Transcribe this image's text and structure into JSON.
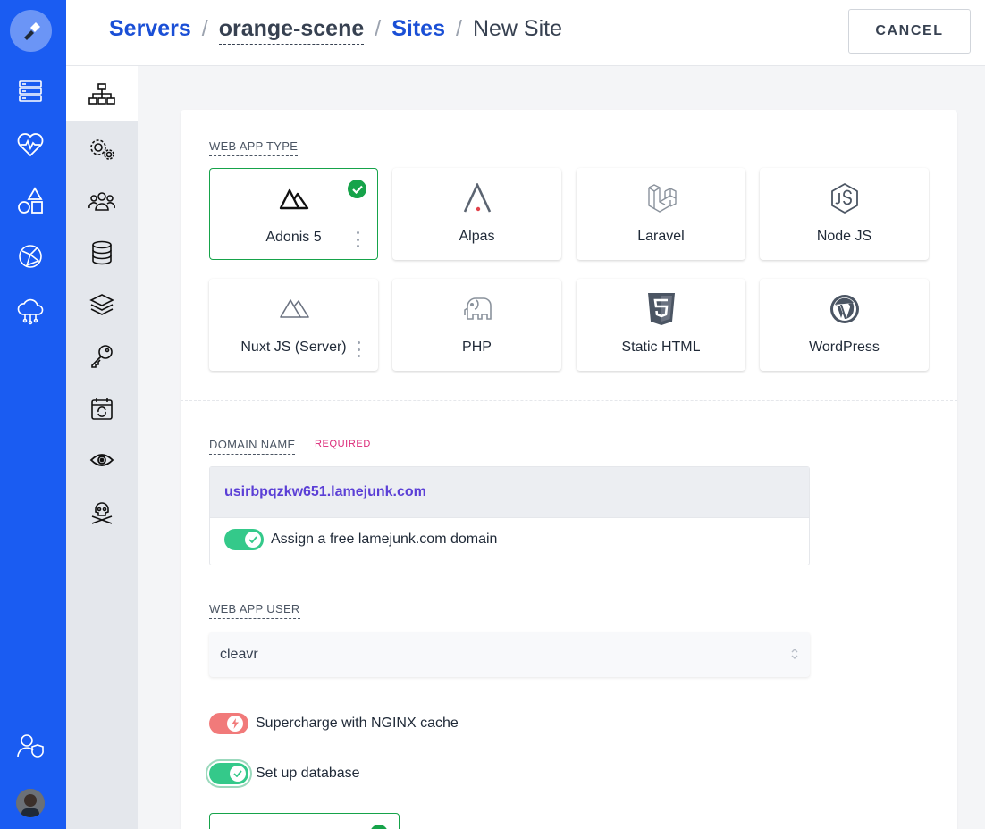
{
  "breadcrumb": {
    "servers": "Servers",
    "server_name": "orange-scene",
    "sites": "Sites",
    "current": "New Site",
    "separator": "/"
  },
  "header": {
    "cancel_label": "CANCEL"
  },
  "rail": {
    "icons": [
      "server-list-icon",
      "heartbeat-icon",
      "shapes-icon",
      "globe-network-icon",
      "cloud-network-icon",
      "user-shield-icon"
    ],
    "bottom_avatar": "avatar"
  },
  "subnav": {
    "items": [
      "sitemap-icon",
      "gears-icon",
      "users-icon",
      "database-icon",
      "layers-icon",
      "key-icon",
      "calendar-sync-icon",
      "eye-icon",
      "skull-crossbones-icon"
    ],
    "active": "sitemap-icon"
  },
  "web_app_type": {
    "label": "WEB APP TYPE",
    "options": [
      {
        "label": "Adonis 5",
        "icon": "adonis-icon",
        "selected": true,
        "has_menu": true
      },
      {
        "label": "Alpas",
        "icon": "alpas-icon",
        "selected": false,
        "has_menu": false
      },
      {
        "label": "Laravel",
        "icon": "laravel-icon",
        "selected": false,
        "has_menu": false
      },
      {
        "label": "Node JS",
        "icon": "nodejs-icon",
        "selected": false,
        "has_menu": false
      },
      {
        "label": "Nuxt JS (Server)",
        "icon": "nuxt-icon",
        "selected": false,
        "has_menu": true
      },
      {
        "label": "PHP",
        "icon": "php-elephant-icon",
        "selected": false,
        "has_menu": false
      },
      {
        "label": "Static HTML",
        "icon": "html5-icon",
        "selected": false,
        "has_menu": false
      },
      {
        "label": "WordPress",
        "icon": "wordpress-icon",
        "selected": false,
        "has_menu": false
      }
    ]
  },
  "domain": {
    "label": "DOMAIN NAME",
    "required": "REQUIRED",
    "value": "usirbpqzkw651.lamejunk.com",
    "free_domain_toggle": {
      "label": "Assign a free lamejunk.com domain",
      "on": true
    }
  },
  "web_app_user": {
    "label": "WEB APP USER",
    "value": "cleavr"
  },
  "nginx_cache": {
    "label": "Supercharge with NGINX cache",
    "on": true
  },
  "database": {
    "label": "Set up database",
    "on": true
  },
  "colors": {
    "rail": "#1a5cf2",
    "link": "#1a4fd6",
    "selected": "#16a34a",
    "toggle_on": "#34c98a",
    "toggle_red": "#f17a7a",
    "required": "#db2777"
  }
}
